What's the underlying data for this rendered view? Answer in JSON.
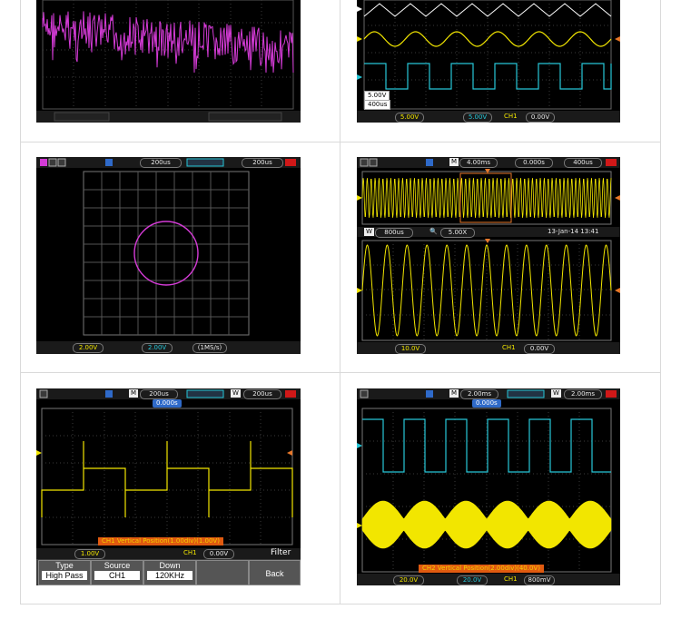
{
  "panels": {
    "p1": {
      "fft_left": "",
      "fft_right": ""
    },
    "p2": {
      "volt": "5.00V",
      "time": "400us",
      "bottom": {
        "ch1": "5.00V",
        "ch2": "5.00V",
        "trig": "CH1",
        "trig_level": "0.00V"
      }
    },
    "p3": {
      "top_time": "200us",
      "top_time2": "200us",
      "bottom": {
        "ch1": "2.00V",
        "ch2": "2.00V",
        "rate": "(1MS/s)"
      }
    },
    "p4": {
      "mode": "M",
      "time": "4.00ms",
      "trig_pos": "0.000s",
      "time2": "400us",
      "win_label": "W",
      "win_time": "800us",
      "zoom": "5.00X",
      "datetime": "13-Jan-14 13:41",
      "bottom": {
        "ch1": "10.0V",
        "trig": "CH1",
        "trig_level": "0.00V"
      }
    },
    "p5": {
      "mode": "M",
      "time": "200us",
      "win_label": "W",
      "win_time": "200us",
      "trig_pos": "0.000s",
      "message": "CH1 Vertical Position(1.00div)(1.00V)",
      "bottom": {
        "ch1": "1.00V",
        "trig": "CH1",
        "trig_level": "0.00V"
      },
      "menu_title": "Filter",
      "menu": [
        {
          "label": "Type",
          "value": "High Pass"
        },
        {
          "label": "Source",
          "value": "CH1"
        },
        {
          "label": "Down",
          "value": "120KHz"
        }
      ],
      "back": "Back"
    },
    "p6": {
      "mode": "M",
      "time": "2.00ms",
      "win_label": "W",
      "win_time": "2.00ms",
      "trig_pos": "0.000s",
      "message": "CH2 Vertical Position(2.00div)(40.0V)",
      "bottom": {
        "ch1": "20.0V",
        "ch2": "20.0V",
        "trig": "CH1",
        "trig_level": "800mV"
      }
    }
  },
  "colors": {
    "ch1": "#f2e600",
    "ch2": "#27c7d8",
    "math": "#d43bd6",
    "ref": "#ffffff",
    "trigger": "#e8782a"
  }
}
